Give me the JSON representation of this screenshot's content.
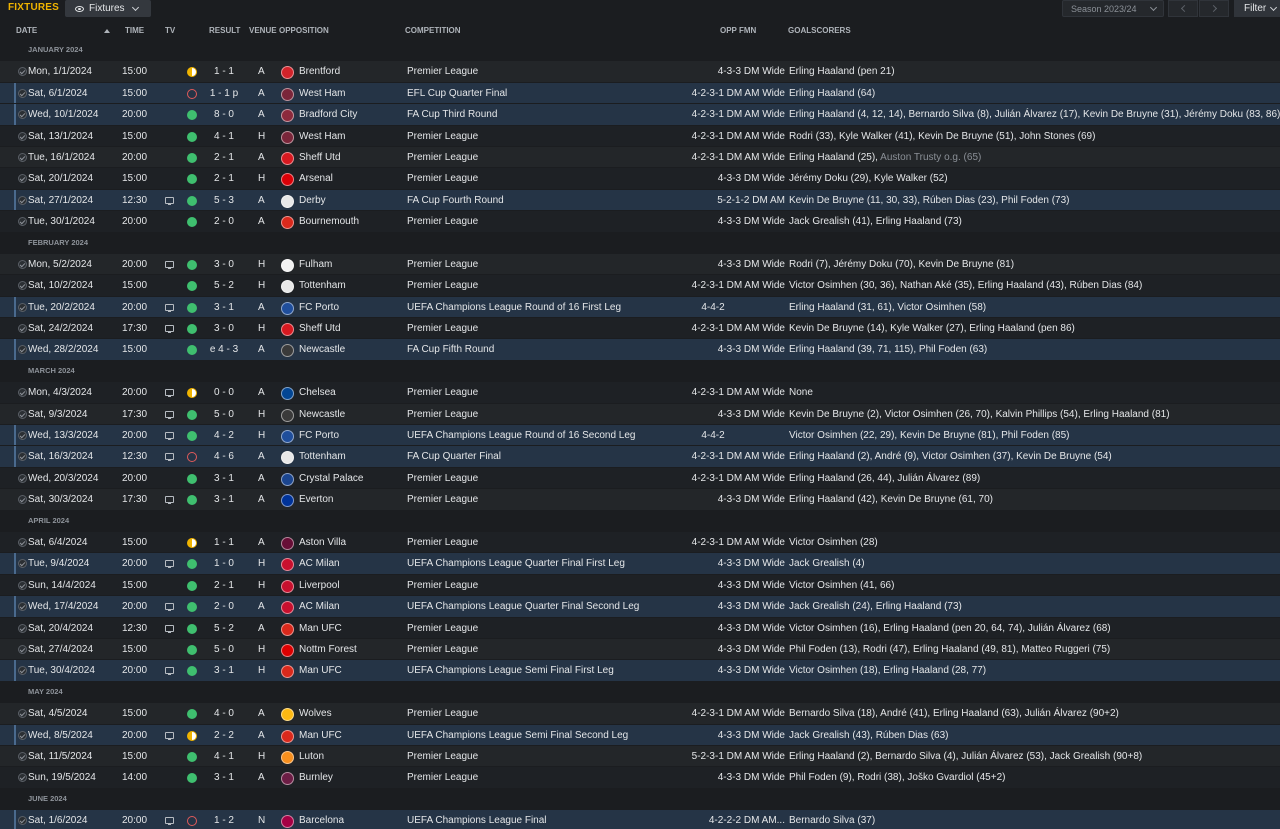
{
  "header": {
    "title": "FIXTURES",
    "view_label": "Fixtures",
    "season_label": "Season 2023/24",
    "filter_label": "Filter"
  },
  "columns": {
    "date": "DATE",
    "time": "TIME",
    "tv": "TV",
    "result": "RESULT",
    "venue": "VENUE",
    "opposition": "OPPOSITION",
    "competition": "COMPETITION",
    "opp_fmn": "OPP FMN",
    "goalscorers": "GOALSCORERS"
  },
  "colors": {
    "accent": "#f0b400",
    "win": "#3fbf6f",
    "draw": "#f0b400",
    "loss": "#e05a5a",
    "highlight_row": "#253446"
  },
  "months": [
    {
      "label": "JANUARY 2024",
      "fixtures": [
        {
          "date": "Mon, 1/1/2024",
          "time": "15:00",
          "tv": false,
          "outcome": "draw",
          "result": "1 - 1",
          "venue": "A",
          "opponent": "Brentford",
          "crest": "#d2232a",
          "competition": "Premier League",
          "fmn": "4-3-3 DM Wide",
          "scorers": "Erling Haaland (pen 21)",
          "hl": false
        },
        {
          "date": "Sat, 6/1/2024",
          "time": "15:00",
          "tv": false,
          "outcome": "loss",
          "result": "1 - 1 p",
          "venue": "A",
          "opponent": "West Ham",
          "crest": "#7a263a",
          "competition": "EFL Cup Quarter Final",
          "fmn": "4-2-3-1 DM AM Wide",
          "scorers": "Erling Haaland (64)",
          "hl": true
        },
        {
          "date": "Wed, 10/1/2024",
          "time": "20:00",
          "tv": false,
          "outcome": "win",
          "result": "8 - 0",
          "venue": "A",
          "opponent": "Bradford City",
          "crest": "#8c2a3c",
          "competition": "FA Cup Third Round",
          "fmn": "4-2-3-1 DM AM Wide",
          "scorers": "Erling Haaland (4, 12, 14), Bernardo Silva (8), Julián Álvarez (17), Kevin De Bruyne (31), Jérémy Doku (83, 86)",
          "hl": true
        },
        {
          "date": "Sat, 13/1/2024",
          "time": "15:00",
          "tv": false,
          "outcome": "win",
          "result": "4 - 1",
          "venue": "H",
          "opponent": "West Ham",
          "crest": "#7a263a",
          "competition": "Premier League",
          "fmn": "4-2-3-1 DM AM Wide",
          "scorers": "Rodri (33), Kyle Walker (41), Kevin De Bruyne (51), John Stones (69)",
          "hl": false
        },
        {
          "date": "Tue, 16/1/2024",
          "time": "20:00",
          "tv": false,
          "outcome": "win",
          "result": "2 - 1",
          "venue": "A",
          "opponent": "Sheff Utd",
          "crest": "#d71920",
          "competition": "Premier League",
          "fmn": "4-2-3-1 DM AM Wide",
          "scorers": "Erling Haaland (25),",
          "og": "Auston Trusty o.g. (65)",
          "hl": false
        },
        {
          "date": "Sat, 20/1/2024",
          "time": "15:00",
          "tv": false,
          "outcome": "win",
          "result": "2 - 1",
          "venue": "H",
          "opponent": "Arsenal",
          "crest": "#db0007",
          "competition": "Premier League",
          "fmn": "4-3-3 DM Wide",
          "scorers": "Jérémy Doku (29), Kyle Walker (52)",
          "hl": false
        },
        {
          "date": "Sat, 27/1/2024",
          "time": "12:30",
          "tv": true,
          "outcome": "win",
          "result": "5 - 3",
          "venue": "A",
          "opponent": "Derby",
          "crest": "#e8e8e8",
          "competition": "FA Cup Fourth Round",
          "fmn": "5-2-1-2 DM AM",
          "scorers": "Kevin De Bruyne (11, 30, 33), Rúben Dias (23), Phil Foden (73)",
          "hl": true
        },
        {
          "date": "Tue, 30/1/2024",
          "time": "20:00",
          "tv": false,
          "outcome": "win",
          "result": "2 - 0",
          "venue": "A",
          "opponent": "Bournemouth",
          "crest": "#da291c",
          "competition": "Premier League",
          "fmn": "4-3-3 DM Wide",
          "scorers": "Jack Grealish (41), Erling Haaland (73)",
          "hl": false
        }
      ]
    },
    {
      "label": "FEBRUARY 2024",
      "fixtures": [
        {
          "date": "Mon, 5/2/2024",
          "time": "20:00",
          "tv": true,
          "outcome": "win",
          "result": "3 - 0",
          "venue": "H",
          "opponent": "Fulham",
          "crest": "#f2f2f2",
          "competition": "Premier League",
          "fmn": "4-3-3 DM Wide",
          "scorers": "Rodri (7), Jérémy Doku (70), Kevin De Bruyne (81)",
          "hl": false
        },
        {
          "date": "Sat, 10/2/2024",
          "time": "15:00",
          "tv": false,
          "outcome": "win",
          "result": "5 - 2",
          "venue": "H",
          "opponent": "Tottenham",
          "crest": "#e8e8e8",
          "competition": "Premier League",
          "fmn": "4-2-3-1 DM AM Wide",
          "scorers": "Victor Osimhen (30, 36), Nathan Aké (35), Erling Haaland (43), Rúben Dias (84)",
          "hl": false
        },
        {
          "date": "Tue, 20/2/2024",
          "time": "20:00",
          "tv": true,
          "outcome": "win",
          "result": "3 - 1",
          "venue": "A",
          "opponent": "FC Porto",
          "crest": "#1f4e9c",
          "competition": "UEFA Champions League Round of 16 First Leg",
          "fmn": "4-4-2",
          "fmn_mid": true,
          "scorers": "Erling Haaland (31, 61), Victor Osimhen (58)",
          "hl": true
        },
        {
          "date": "Sat, 24/2/2024",
          "time": "17:30",
          "tv": true,
          "outcome": "win",
          "result": "3 - 0",
          "venue": "H",
          "opponent": "Sheff Utd",
          "crest": "#d71920",
          "competition": "Premier League",
          "fmn": "4-2-3-1 DM AM Wide",
          "scorers": "Kevin De Bruyne (14), Kyle Walker (27), Erling Haaland (pen 86)",
          "hl": false
        },
        {
          "date": "Wed, 28/2/2024",
          "time": "15:00",
          "tv": false,
          "outcome": "win",
          "result": "e 4 - 3",
          "venue": "A",
          "opponent": "Newcastle",
          "crest": "#3a3a3a",
          "competition": "FA Cup Fifth Round",
          "fmn": "4-3-3 DM Wide",
          "scorers": "Erling Haaland (39, 71, 115), Phil Foden (63)",
          "hl": true
        }
      ]
    },
    {
      "label": "MARCH 2024",
      "fixtures": [
        {
          "date": "Mon, 4/3/2024",
          "time": "20:00",
          "tv": true,
          "outcome": "draw",
          "result": "0 - 0",
          "venue": "A",
          "opponent": "Chelsea",
          "crest": "#034694",
          "competition": "Premier League",
          "fmn": "4-2-3-1 DM AM Wide",
          "scorers": "None",
          "hl": false
        },
        {
          "date": "Sat, 9/3/2024",
          "time": "17:30",
          "tv": true,
          "outcome": "win",
          "result": "5 - 0",
          "venue": "H",
          "opponent": "Newcastle",
          "crest": "#3a3a3a",
          "competition": "Premier League",
          "fmn": "4-3-3 DM Wide",
          "scorers": "Kevin De Bruyne (2), Victor Osimhen (26, 70), Kalvin Phillips (54), Erling Haaland (81)",
          "hl": false
        },
        {
          "date": "Wed, 13/3/2024",
          "time": "20:00",
          "tv": true,
          "outcome": "win",
          "result": "4 - 2",
          "venue": "H",
          "opponent": "FC Porto",
          "crest": "#1f4e9c",
          "competition": "UEFA Champions League Round of 16 Second Leg",
          "fmn": "4-4-2",
          "fmn_mid": true,
          "scorers": "Victor Osimhen (22, 29), Kevin De Bruyne (81), Phil Foden (85)",
          "hl": true
        },
        {
          "date": "Sat, 16/3/2024",
          "time": "12:30",
          "tv": true,
          "outcome": "loss",
          "result": "4 - 6",
          "venue": "A",
          "opponent": "Tottenham",
          "crest": "#e8e8e8",
          "competition": "FA Cup Quarter Final",
          "fmn": "4-2-3-1 DM AM Wide",
          "scorers": "Erling Haaland (2), André (9), Victor Osimhen (37), Kevin De Bruyne (54)",
          "hl": true
        },
        {
          "date": "Wed, 20/3/2024",
          "time": "20:00",
          "tv": false,
          "outcome": "win",
          "result": "3 - 1",
          "venue": "A",
          "opponent": "Crystal Palace",
          "crest": "#1b458f",
          "competition": "Premier League",
          "fmn": "4-2-3-1 DM AM Wide",
          "scorers": "Erling Haaland (26, 44), Julián Álvarez (89)",
          "hl": false
        },
        {
          "date": "Sat, 30/3/2024",
          "time": "17:30",
          "tv": true,
          "outcome": "win",
          "result": "3 - 1",
          "venue": "A",
          "opponent": "Everton",
          "crest": "#003399",
          "competition": "Premier League",
          "fmn": "4-3-3 DM Wide",
          "scorers": "Erling Haaland (42), Kevin De Bruyne (61, 70)",
          "hl": false
        }
      ]
    },
    {
      "label": "APRIL 2024",
      "fixtures": [
        {
          "date": "Sat, 6/4/2024",
          "time": "15:00",
          "tv": false,
          "outcome": "draw",
          "result": "1 - 1",
          "venue": "A",
          "opponent": "Aston Villa",
          "crest": "#670e36",
          "competition": "Premier League",
          "fmn": "4-2-3-1 DM AM Wide",
          "scorers": "Victor Osimhen (28)",
          "hl": false
        },
        {
          "date": "Tue, 9/4/2024",
          "time": "20:00",
          "tv": true,
          "outcome": "win",
          "result": "1 - 0",
          "venue": "H",
          "opponent": "AC Milan",
          "crest": "#c8102e",
          "competition": "UEFA Champions League Quarter Final First Leg",
          "fmn": "4-3-3 DM Wide",
          "scorers": "Jack Grealish (4)",
          "hl": true
        },
        {
          "date": "Sun, 14/4/2024",
          "time": "15:00",
          "tv": false,
          "outcome": "win",
          "result": "2 - 1",
          "venue": "H",
          "opponent": "Liverpool",
          "crest": "#c8102e",
          "competition": "Premier League",
          "fmn": "4-3-3 DM Wide",
          "scorers": "Victor Osimhen (41, 66)",
          "hl": false
        },
        {
          "date": "Wed, 17/4/2024",
          "time": "20:00",
          "tv": true,
          "outcome": "win",
          "result": "2 - 0",
          "venue": "A",
          "opponent": "AC Milan",
          "crest": "#c8102e",
          "competition": "UEFA Champions League Quarter Final Second Leg",
          "fmn": "4-3-3 DM Wide",
          "scorers": "Jack Grealish (24), Erling Haaland (73)",
          "hl": true
        },
        {
          "date": "Sat, 20/4/2024",
          "time": "12:30",
          "tv": true,
          "outcome": "win",
          "result": "5 - 2",
          "venue": "A",
          "opponent": "Man UFC",
          "crest": "#da291c",
          "competition": "Premier League",
          "fmn": "4-3-3 DM Wide",
          "scorers": "Victor Osimhen (16), Erling Haaland (pen 20, 64, 74), Julián Álvarez (68)",
          "hl": false
        },
        {
          "date": "Sat, 27/4/2024",
          "time": "15:00",
          "tv": false,
          "outcome": "win",
          "result": "5 - 0",
          "venue": "H",
          "opponent": "Nottm Forest",
          "crest": "#dd0000",
          "competition": "Premier League",
          "fmn": "4-3-3 DM Wide",
          "scorers": "Phil Foden (13), Rodri (47), Erling Haaland (49, 81), Matteo Ruggeri (75)",
          "hl": false
        },
        {
          "date": "Tue, 30/4/2024",
          "time": "20:00",
          "tv": true,
          "outcome": "win",
          "result": "3 - 1",
          "venue": "H",
          "opponent": "Man UFC",
          "crest": "#da291c",
          "competition": "UEFA Champions League Semi Final First Leg",
          "fmn": "4-3-3 DM Wide",
          "scorers": "Victor Osimhen (18), Erling Haaland (28, 77)",
          "hl": true
        }
      ]
    },
    {
      "label": "MAY 2024",
      "fixtures": [
        {
          "date": "Sat, 4/5/2024",
          "time": "15:00",
          "tv": false,
          "outcome": "win",
          "result": "4 - 0",
          "venue": "A",
          "opponent": "Wolves",
          "crest": "#fdb913",
          "competition": "Premier League",
          "fmn": "4-2-3-1 DM AM Wide",
          "scorers": "Bernardo Silva (18), André (41), Erling Haaland (63), Julián Álvarez (90+2)",
          "hl": false
        },
        {
          "date": "Wed, 8/5/2024",
          "time": "20:00",
          "tv": true,
          "outcome": "draw",
          "result": "2 - 2",
          "venue": "A",
          "opponent": "Man UFC",
          "crest": "#da291c",
          "competition": "UEFA Champions League Semi Final Second Leg",
          "fmn": "4-3-3 DM Wide",
          "scorers": "Jack Grealish (43), Rúben Dias (63)",
          "hl": true
        },
        {
          "date": "Sat, 11/5/2024",
          "time": "15:00",
          "tv": false,
          "outcome": "win",
          "result": "4 - 1",
          "venue": "H",
          "opponent": "Luton",
          "crest": "#f78f1e",
          "competition": "Premier League",
          "fmn": "5-2-3-1 DM AM Wide",
          "scorers": "Erling Haaland (2), Bernardo Silva (4), Julián Álvarez (53), Jack Grealish (90+8)",
          "hl": false
        },
        {
          "date": "Sun, 19/5/2024",
          "time": "14:00",
          "tv": false,
          "outcome": "win",
          "result": "3 - 1",
          "venue": "A",
          "opponent": "Burnley",
          "crest": "#6c1d45",
          "competition": "Premier League",
          "fmn": "4-3-3 DM Wide",
          "scorers": "Phil Foden (9), Rodri (38), Joško Gvardiol (45+2)",
          "hl": false
        }
      ]
    },
    {
      "label": "JUNE 2024",
      "fixtures": [
        {
          "date": "Sat, 1/6/2024",
          "time": "20:00",
          "tv": true,
          "outcome": "loss",
          "result": "1 - 2",
          "venue": "N",
          "opponent": "Barcelona",
          "crest": "#a50044",
          "competition": "UEFA Champions League Final",
          "fmn": "4-2-2-2 DM AM...",
          "scorers": "Bernardo Silva (37)",
          "hl": true
        }
      ]
    }
  ]
}
